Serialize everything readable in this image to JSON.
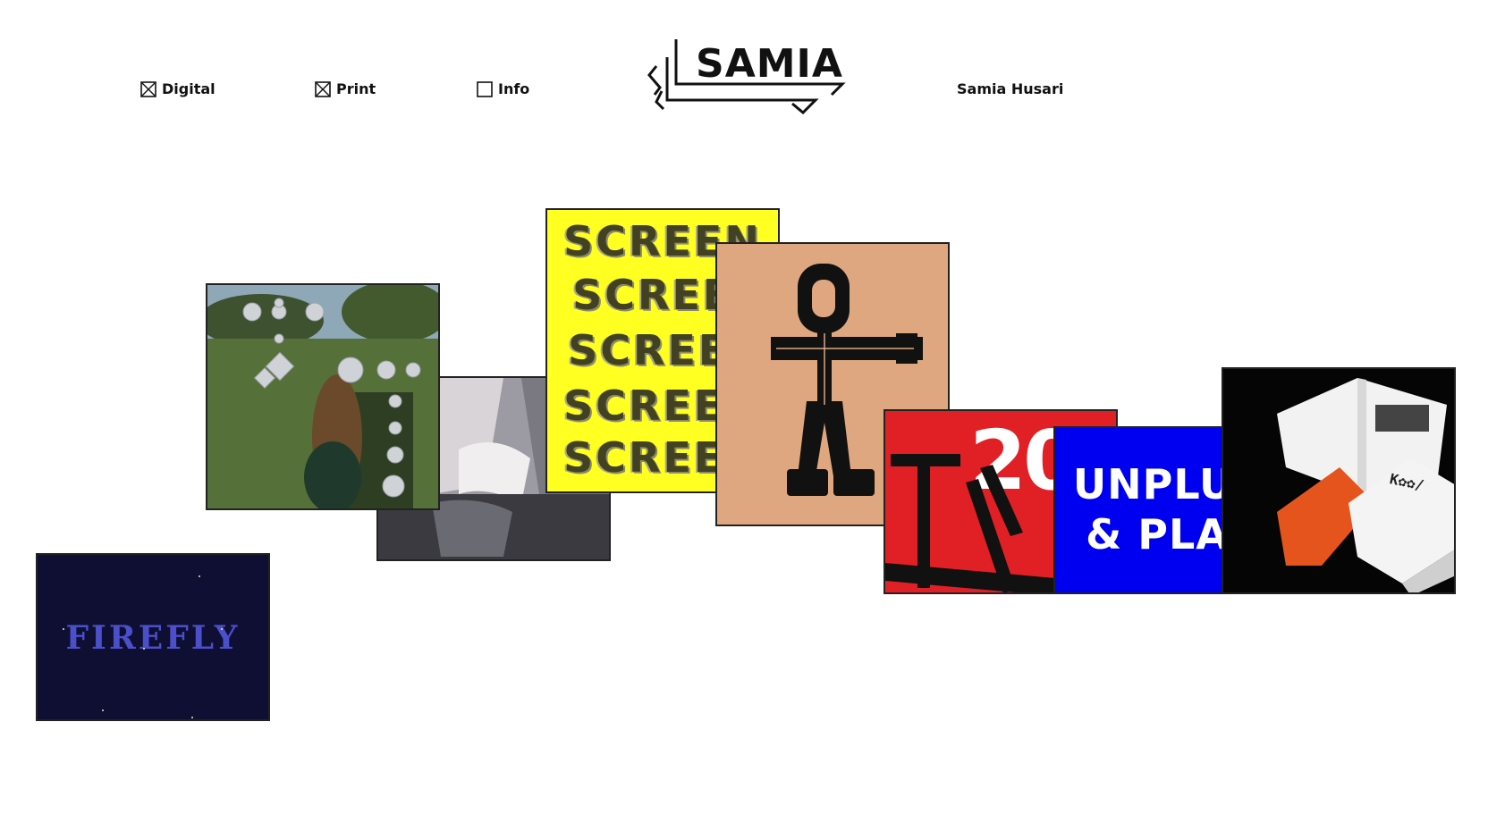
{
  "nav": {
    "items": [
      {
        "label": "Digital",
        "checked": true
      },
      {
        "label": "Print",
        "checked": true
      },
      {
        "label": "Info",
        "checked": false
      }
    ]
  },
  "logo": {
    "text": "SAMIA"
  },
  "author": {
    "name": "Samia Husari"
  },
  "projects": {
    "firefly": {
      "title": "FIREFLY"
    },
    "screen": {
      "lines": [
        "SCREEN",
        "SCREEN",
        "SCREEN",
        "SCREEN",
        "SCREEN"
      ]
    },
    "tv": {
      "number": "20"
    },
    "unplug": {
      "line1": "UNPLUG",
      "line2": "& PLAY"
    },
    "koo": {
      "label": "K✿✿/"
    }
  },
  "colors": {
    "firefly_bg": "#0f0f33",
    "screen_bg": "#ffff22",
    "figure_bg": "#dea780",
    "tv_bg": "#e12025",
    "unplug_bg": "#0000f0"
  }
}
